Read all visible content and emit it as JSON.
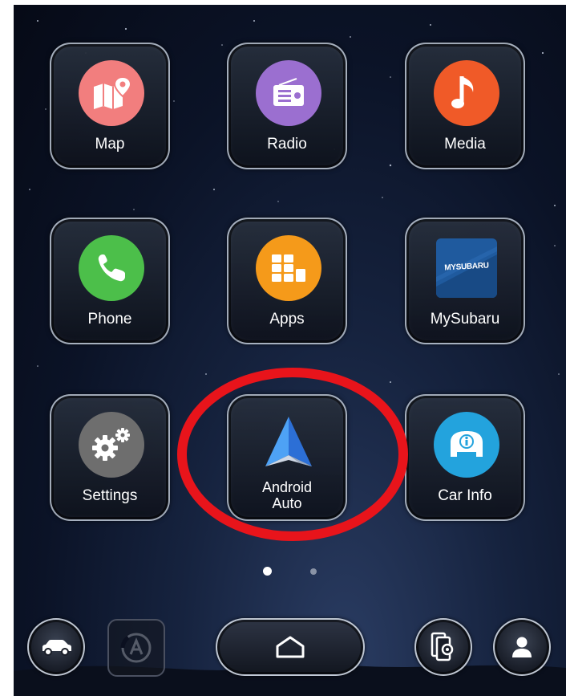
{
  "tiles": [
    {
      "label": "Map",
      "icon": "map-icon",
      "color": "#f27e7e"
    },
    {
      "label": "Radio",
      "icon": "radio-icon",
      "color": "#9b6fd0"
    },
    {
      "label": "Media",
      "icon": "music-note-icon",
      "color": "#f05a28"
    },
    {
      "label": "Phone",
      "icon": "phone-icon",
      "color": "#4cbf4a"
    },
    {
      "label": "Apps",
      "icon": "apps-grid-icon",
      "color": "#f59a1a"
    },
    {
      "label": "MySubaru",
      "icon": "mysubaru-logo-icon",
      "color": "#1f5a9e",
      "logo_text": "MYSUBARU"
    },
    {
      "label": "Settings",
      "icon": "gears-icon",
      "color": "#6e6e6e"
    },
    {
      "label_line1": "Android",
      "label_line2": "Auto",
      "icon": "android-auto-icon",
      "color": "#4a8ef0"
    },
    {
      "label": "Car Info",
      "icon": "car-info-icon",
      "color": "#23a3dd"
    }
  ],
  "page_indicator": {
    "current": 1,
    "total": 2
  },
  "highlight_color": "#e8141b",
  "bottom_bar": {
    "items": [
      "car-icon",
      "auto-mode-icon",
      "home-icon",
      "phone-settings-icon",
      "profile-icon"
    ]
  }
}
